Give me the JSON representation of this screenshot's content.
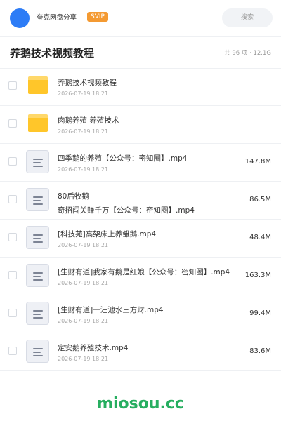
{
  "header": {
    "app_name": "夸克网盘分享",
    "badge": "SVIP",
    "search_label": "搜索",
    "accent_color": "#2d7cf6"
  },
  "folder": {
    "title": "养鹅技术视频教程",
    "stats": "共 96 项 · 12.1G"
  },
  "files": [
    {
      "type": "folder",
      "icon": "folder-icon",
      "name": "养鹅技术视频教程",
      "date": "2026-07-19 18:21",
      "size": ""
    },
    {
      "type": "folder",
      "icon": "folder-icon",
      "name": "肉鹅养殖 养殖技术",
      "date": "2026-07-19 18:21",
      "size": ""
    },
    {
      "type": "file",
      "icon": "document-icon",
      "name": "四季鹅的养殖【公众号：密知圈】.mp4",
      "date": "2026-07-19 18:21",
      "size": "147.8M"
    },
    {
      "type": "file",
      "icon": "document-icon",
      "name": "80后牧鹅",
      "name_line2": "奇招闯关赚千万【公众号：密知圈】.mp4",
      "date": "",
      "size": "86.5M"
    },
    {
      "type": "file",
      "icon": "document-icon",
      "name": "[科技苑]高架床上养雏鹅.mp4",
      "date": "2026-07-19 18:21",
      "size": "48.4M"
    },
    {
      "type": "file",
      "icon": "document-icon",
      "name": "[生财有道]我家有鹅是红娘【公众号：密知圈】.mp4",
      "date": "2026-07-19 18:21",
      "size": "163.3M"
    },
    {
      "type": "file",
      "icon": "document-icon",
      "name": "[生财有道]一汪池水三方财.mp4",
      "date": "2026-07-19 18:21",
      "size": "99.4M"
    },
    {
      "type": "file",
      "icon": "document-icon",
      "name": "定安鹅养殖技术.mp4",
      "date": "2026-07-19 18:21",
      "size": "83.6M"
    }
  ],
  "watermark": "miosou.cc"
}
